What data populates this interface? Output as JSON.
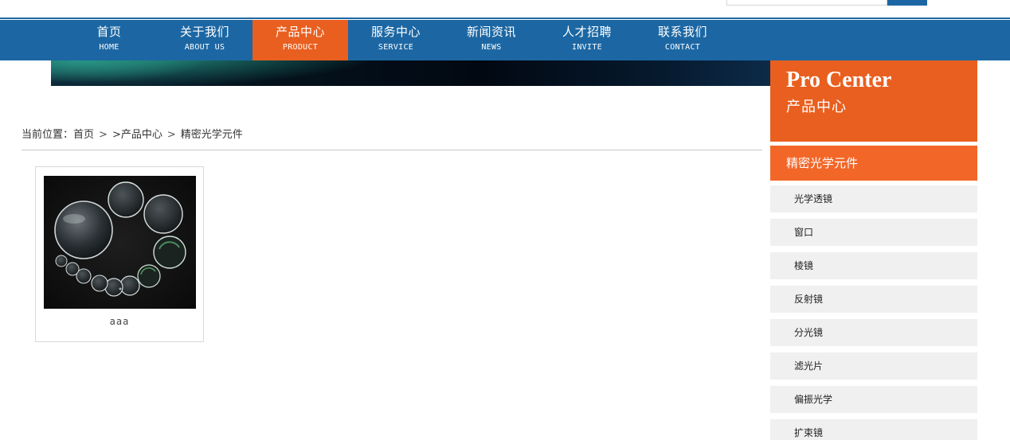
{
  "search": {
    "placeholder": ""
  },
  "nav": {
    "items": [
      {
        "zh": "首页",
        "en": "HOME"
      },
      {
        "zh": "关于我们",
        "en": "ABOUT US"
      },
      {
        "zh": "产品中心",
        "en": "PRODUCT"
      },
      {
        "zh": "服务中心",
        "en": "SERVICE"
      },
      {
        "zh": "新闻资讯",
        "en": "NEWS"
      },
      {
        "zh": "人才招聘",
        "en": "INVITE"
      },
      {
        "zh": "联系我们",
        "en": "CONTACT"
      }
    ],
    "active_index": 2
  },
  "breadcrumb": {
    "prefix": "当前位置：",
    "home": "首页",
    "sep": ">",
    "section": ">产品中心",
    "current": "精密光学元件"
  },
  "products": [
    {
      "name": "aaa",
      "image": "optical-lenses-photo"
    }
  ],
  "sidebar": {
    "title_en": "Pro Center",
    "title_zh": "产品中心",
    "category": "精密光学元件",
    "items": [
      "光学透镜",
      "窗口",
      "棱镜",
      "反射镜",
      "分光镜",
      "滤光片",
      "偏振光学",
      "扩束镜"
    ]
  },
  "colors": {
    "nav_blue": "#1c67a3",
    "accent_orange": "#e95f1f",
    "category_orange": "#f26628",
    "sidebar_item_bg": "#f0f0f0"
  }
}
